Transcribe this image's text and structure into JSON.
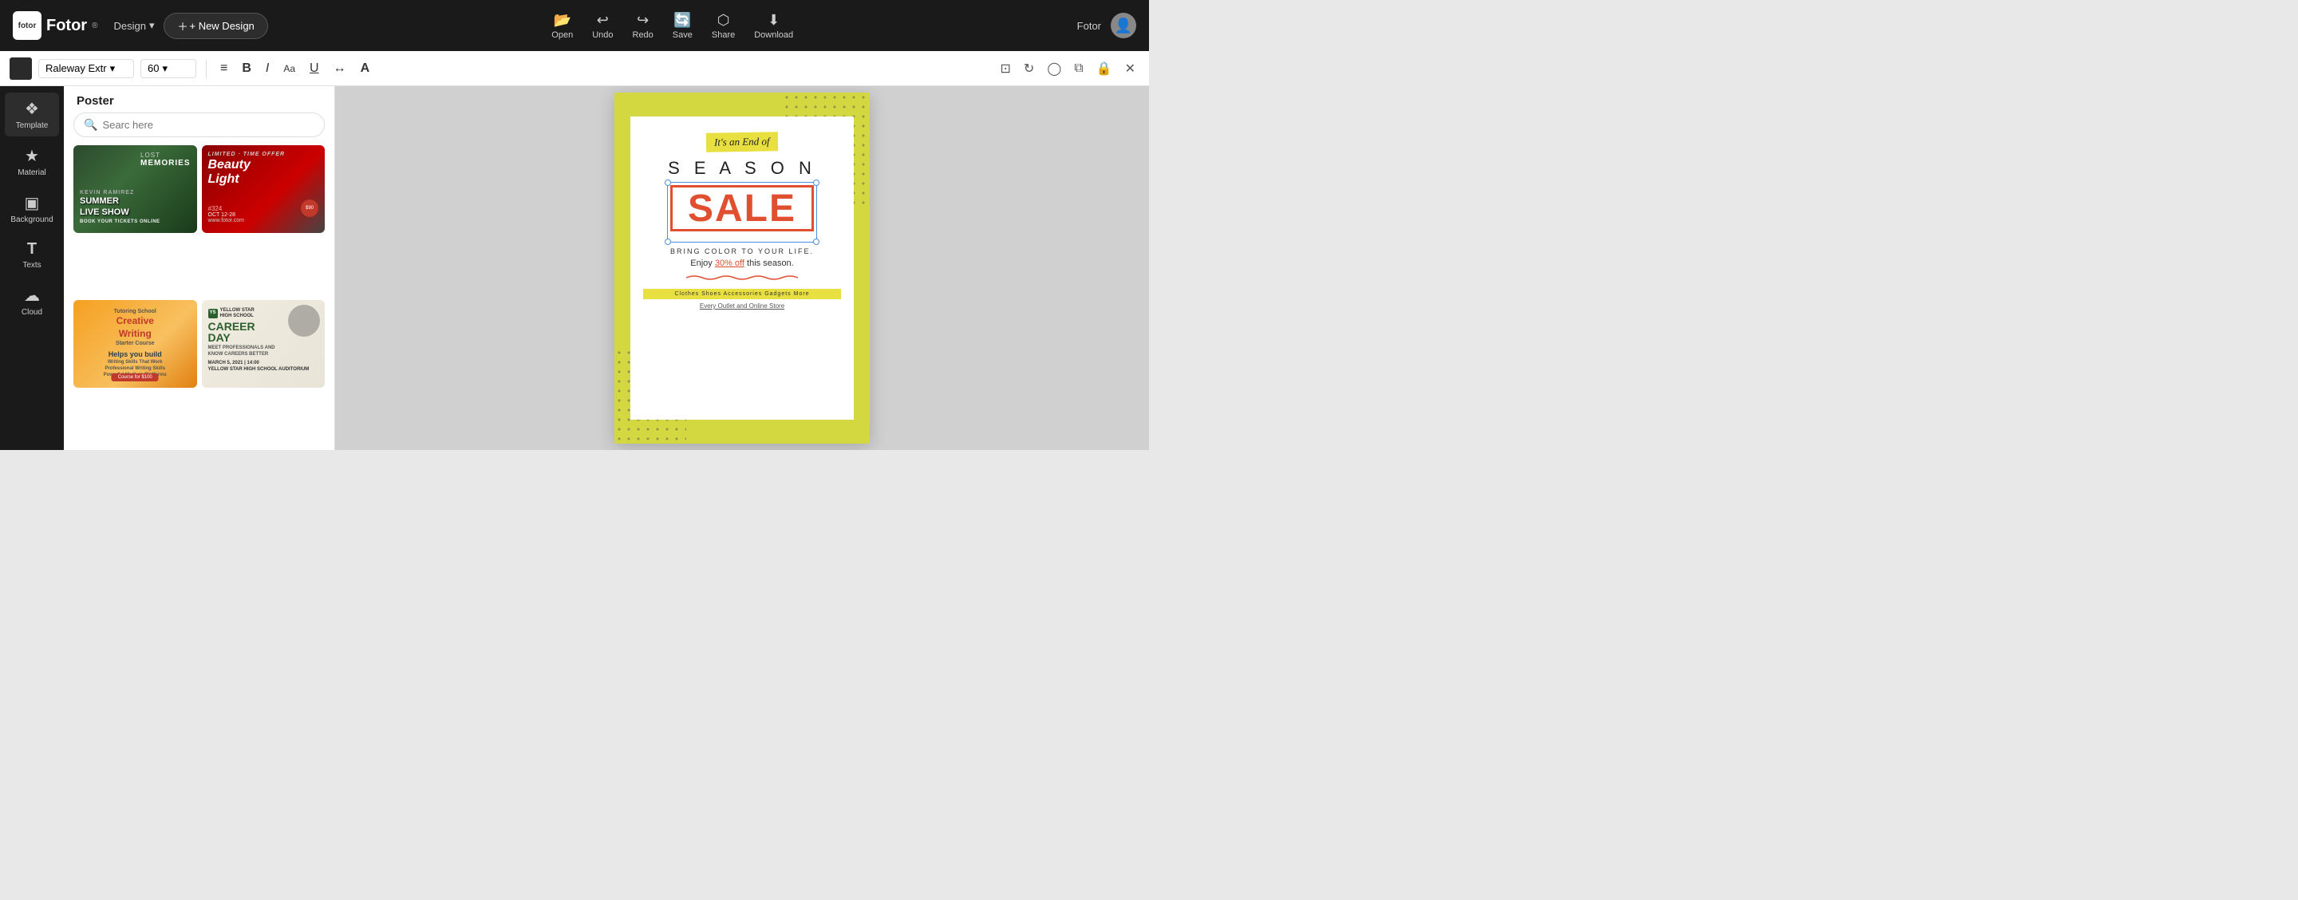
{
  "app": {
    "name": "Fotor",
    "logo_sup": "®"
  },
  "topbar": {
    "design_label": "Design",
    "new_design_label": "+ New Design",
    "actions": [
      {
        "id": "open",
        "label": "Open",
        "icon": "⬜"
      },
      {
        "id": "undo",
        "label": "Undo",
        "icon": "↩"
      },
      {
        "id": "redo",
        "label": "Redo",
        "icon": "↪"
      },
      {
        "id": "save",
        "label": "Save",
        "icon": "🔄"
      },
      {
        "id": "share",
        "label": "Share",
        "icon": "⬡"
      },
      {
        "id": "download",
        "label": "Download",
        "icon": "⬇"
      }
    ],
    "user_name": "Fotor"
  },
  "toolbar2": {
    "font_color": "#2a2a2a",
    "font_name": "Raleway Extr",
    "font_size": "60",
    "buttons": {
      "align": "≡",
      "bold": "B",
      "italic": "I",
      "size_aa": "Aa",
      "underline": "U",
      "spacing": "↔",
      "case": "A"
    },
    "right_icons": [
      "⊡",
      "↻",
      "◯",
      "⧉",
      "🔒",
      "✕"
    ]
  },
  "sidebar": {
    "items": [
      {
        "id": "template",
        "label": "Template",
        "icon": "❖"
      },
      {
        "id": "material",
        "label": "Material",
        "icon": "★"
      },
      {
        "id": "background",
        "label": "Background",
        "icon": "▣"
      },
      {
        "id": "texts",
        "label": "Texts",
        "icon": "T"
      },
      {
        "id": "cloud",
        "label": "Cloud",
        "icon": "☁"
      }
    ]
  },
  "panel": {
    "title": "Poster",
    "search_placeholder": "Searc here",
    "templates": [
      {
        "id": "t1",
        "title": "SUMMER LIVE SHOW",
        "subtitle": "Lost Memories",
        "style": "dark-green"
      },
      {
        "id": "t2",
        "title": "Beauty Light",
        "subtitle": "#324",
        "style": "dark-red"
      },
      {
        "id": "t3",
        "title": "Creative Writing",
        "subtitle": "Helps you build",
        "style": "orange"
      },
      {
        "id": "t4",
        "title": "CAREER DAY",
        "subtitle": "Yellow Star High School",
        "style": "light"
      }
    ]
  },
  "poster": {
    "tag": "It's an End of",
    "season": "S E A S O N",
    "sale": "SALE",
    "bring_color": "BRING COLOR TO YOUR LIFE.",
    "enjoy": "Enjoy",
    "off": "30% off",
    "this_season": "this season.",
    "categories": "Clothes  Shoes  Accessories  Gadgets  More",
    "every_outlet": "Every Outlet and Online Store"
  }
}
